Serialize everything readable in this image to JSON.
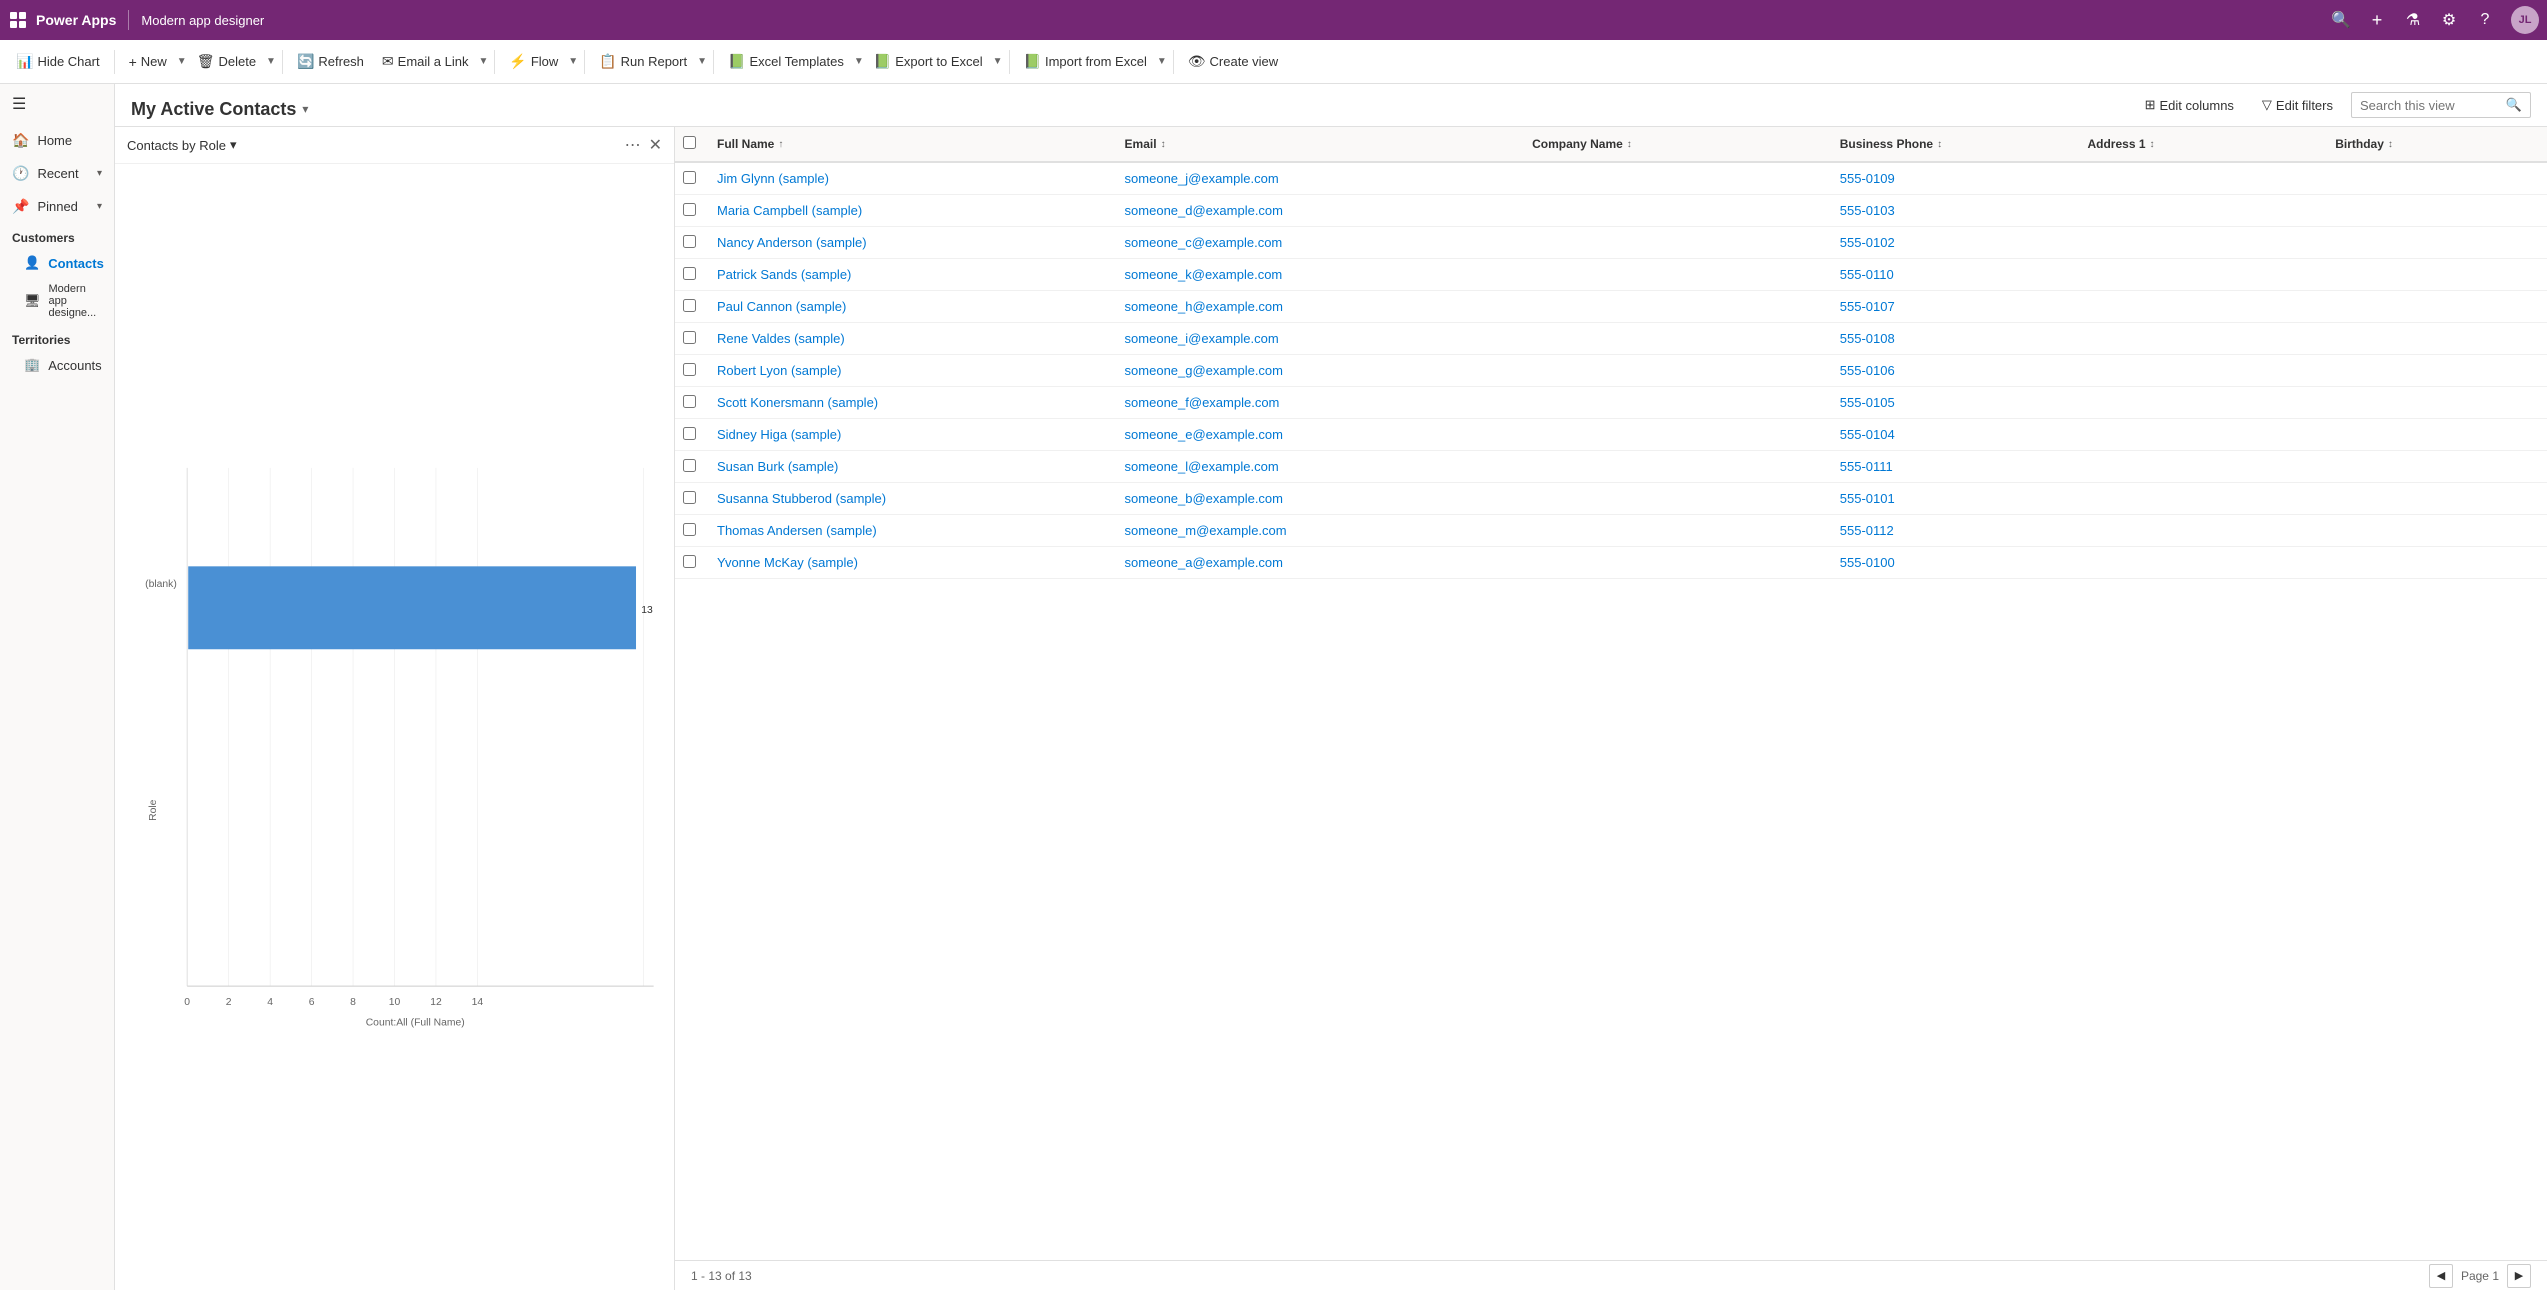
{
  "topbar": {
    "app_name": "Power Apps",
    "page_title": "Modern app designer",
    "icons": {
      "search": "🔍",
      "add": "+",
      "filter": "⚗",
      "settings": "⚙",
      "help": "?",
      "avatar_initials": "JL"
    }
  },
  "toolbar": {
    "hide_chart": "Hide Chart",
    "new": "New",
    "delete": "Delete",
    "refresh": "Refresh",
    "email_link": "Email a Link",
    "flow": "Flow",
    "run_report": "Run Report",
    "excel_templates": "Excel Templates",
    "export_to_excel": "Export to Excel",
    "import_from_excel": "Import from Excel",
    "create_view": "Create view"
  },
  "sidebar": {
    "hamburger": "☰",
    "nav_items": [
      {
        "id": "home",
        "icon": "🏠",
        "label": "Home"
      },
      {
        "id": "recent",
        "icon": "🕐",
        "label": "Recent",
        "has_chevron": true
      },
      {
        "id": "pinned",
        "icon": "📌",
        "label": "Pinned",
        "has_chevron": true
      }
    ],
    "sections": [
      {
        "label": "Customers",
        "items": [
          {
            "id": "contacts",
            "icon": "👤",
            "label": "Contacts",
            "active": true
          },
          {
            "id": "modern-app-designer",
            "icon": "🖥",
            "label": "Modern app designe..."
          }
        ]
      },
      {
        "label": "Territories",
        "items": [
          {
            "id": "accounts",
            "icon": "🏢",
            "label": "Accounts"
          }
        ]
      }
    ]
  },
  "view": {
    "title": "My Active Contacts",
    "chart_panel": {
      "title": "Contacts by Role",
      "data_label": "13",
      "blank_label": "(blank)",
      "role_label": "Role",
      "x_axis_label": "Count:All (Full Name)",
      "x_ticks": [
        "0",
        "2",
        "4",
        "6",
        "8",
        "10",
        "12",
        "14"
      ]
    },
    "columns": [
      {
        "id": "fullname",
        "label": "Full Name",
        "sortable": true,
        "sort": "asc"
      },
      {
        "id": "email",
        "label": "Email",
        "sortable": true
      },
      {
        "id": "company",
        "label": "Company Name",
        "sortable": true
      },
      {
        "id": "phone",
        "label": "Business Phone",
        "sortable": true
      },
      {
        "id": "address",
        "label": "Address 1",
        "sortable": true
      },
      {
        "id": "birthday",
        "label": "Birthday",
        "sortable": true
      }
    ],
    "rows": [
      {
        "fullname": "Jim Glynn (sample)",
        "email": "someone_j@example.com",
        "company": "",
        "phone": "555-0109",
        "address": "",
        "birthday": ""
      },
      {
        "fullname": "Maria Campbell (sample)",
        "email": "someone_d@example.com",
        "company": "",
        "phone": "555-0103",
        "address": "",
        "birthday": ""
      },
      {
        "fullname": "Nancy Anderson (sample)",
        "email": "someone_c@example.com",
        "company": "",
        "phone": "555-0102",
        "address": "",
        "birthday": ""
      },
      {
        "fullname": "Patrick Sands (sample)",
        "email": "someone_k@example.com",
        "company": "",
        "phone": "555-0110",
        "address": "",
        "birthday": ""
      },
      {
        "fullname": "Paul Cannon (sample)",
        "email": "someone_h@example.com",
        "company": "",
        "phone": "555-0107",
        "address": "",
        "birthday": ""
      },
      {
        "fullname": "Rene Valdes (sample)",
        "email": "someone_i@example.com",
        "company": "",
        "phone": "555-0108",
        "address": "",
        "birthday": ""
      },
      {
        "fullname": "Robert Lyon (sample)",
        "email": "someone_g@example.com",
        "company": "",
        "phone": "555-0106",
        "address": "",
        "birthday": ""
      },
      {
        "fullname": "Scott Konersmann (sample)",
        "email": "someone_f@example.com",
        "company": "",
        "phone": "555-0105",
        "address": "",
        "birthday": ""
      },
      {
        "fullname": "Sidney Higa (sample)",
        "email": "someone_e@example.com",
        "company": "",
        "phone": "555-0104",
        "address": "",
        "birthday": ""
      },
      {
        "fullname": "Susan Burk (sample)",
        "email": "someone_l@example.com",
        "company": "",
        "phone": "555-0111",
        "address": "",
        "birthday": ""
      },
      {
        "fullname": "Susanna Stubberod (sample)",
        "email": "someone_b@example.com",
        "company": "",
        "phone": "555-0101",
        "address": "",
        "birthday": ""
      },
      {
        "fullname": "Thomas Andersen (sample)",
        "email": "someone_m@example.com",
        "company": "",
        "phone": "555-0112",
        "address": "",
        "birthday": ""
      },
      {
        "fullname": "Yvonne McKay (sample)",
        "email": "someone_a@example.com",
        "company": "",
        "phone": "555-0100",
        "address": "",
        "birthday": ""
      }
    ],
    "footer": {
      "range": "1 - 13 of 13",
      "page": "Page 1"
    },
    "header_actions": {
      "edit_columns": "Edit columns",
      "edit_filters": "Edit filters",
      "search_placeholder": "Search this view"
    }
  }
}
